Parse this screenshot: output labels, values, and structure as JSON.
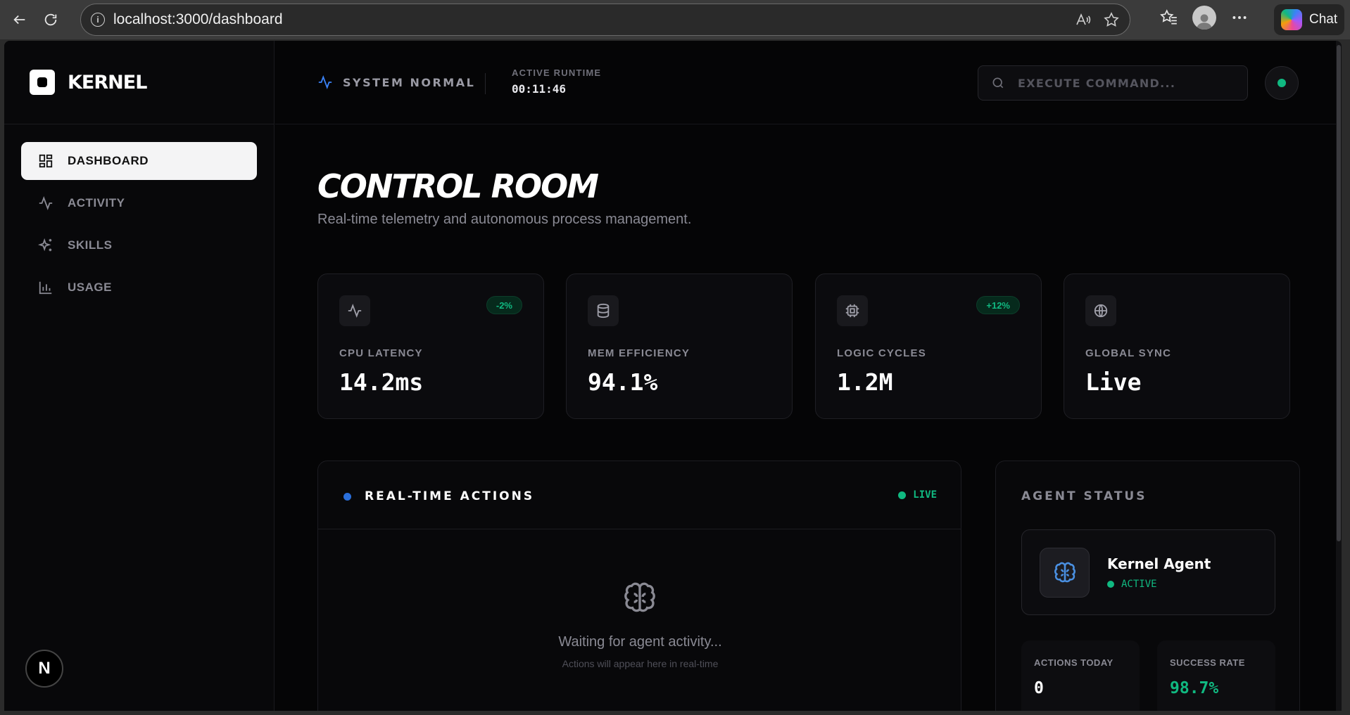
{
  "browser": {
    "url": "localhost:3000/dashboard",
    "chat_label": "Chat"
  },
  "sidebar": {
    "brand": "KERNEL",
    "items": [
      {
        "label": "DASHBOARD",
        "icon": "grid-icon",
        "active": true
      },
      {
        "label": "ACTIVITY",
        "icon": "pulse-icon",
        "active": false
      },
      {
        "label": "SKILLS",
        "icon": "sparkles-icon",
        "active": false
      },
      {
        "label": "USAGE",
        "icon": "bar-chart-icon",
        "active": false
      }
    ],
    "badge": "N"
  },
  "topbar": {
    "system_status": "SYSTEM NORMAL",
    "runtime_label": "ACTIVE RUNTIME",
    "runtime_value": "00:11:46",
    "command_placeholder": "EXECUTE COMMAND..."
  },
  "page": {
    "title": "CONTROL ROOM",
    "subtitle": "Real-time telemetry and autonomous process management."
  },
  "stats": [
    {
      "label": "CPU LATENCY",
      "value": "14.2ms",
      "badge": "-2%",
      "icon": "pulse-icon"
    },
    {
      "label": "MEM EFFICIENCY",
      "value": "94.1%",
      "badge": "",
      "icon": "database-icon"
    },
    {
      "label": "LOGIC CYCLES",
      "value": "1.2M",
      "badge": "+12%",
      "icon": "cpu-icon"
    },
    {
      "label": "GLOBAL SYNC",
      "value": "Live",
      "badge": "",
      "icon": "globe-icon"
    }
  ],
  "actions": {
    "title": "REAL-TIME ACTIONS",
    "live_label": "LIVE",
    "empty_title": "Waiting for agent activity...",
    "empty_sub": "Actions will appear here in real-time"
  },
  "agent": {
    "title": "AGENT STATUS",
    "name": "Kernel Agent",
    "status": "ACTIVE",
    "actions_today_label": "ACTIONS TODAY",
    "actions_today_value": "0",
    "success_rate_label": "SUCCESS RATE",
    "success_rate_value": "98.7%"
  },
  "colors": {
    "accent_green": "#10b981",
    "accent_blue": "#2a6fdb",
    "background": "#050506"
  }
}
